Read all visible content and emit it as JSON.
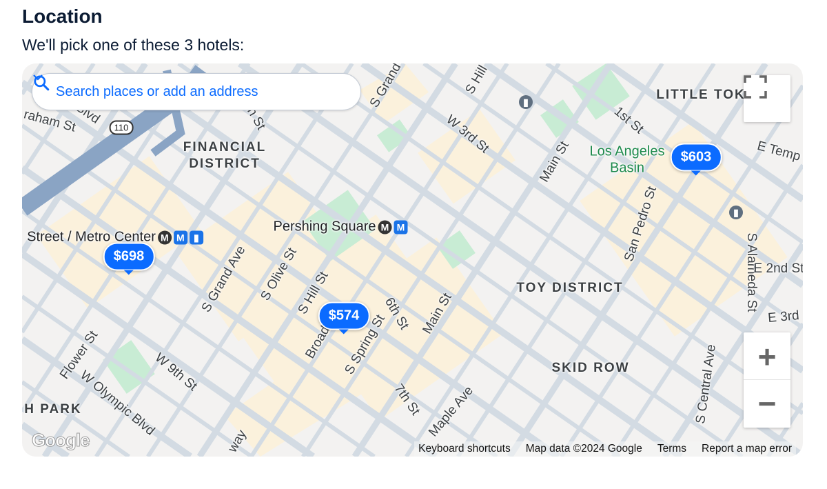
{
  "section": {
    "title": "Location",
    "subtitle": "We'll pick one of these 3 hotels:"
  },
  "map": {
    "search": {
      "placeholder": "Search places or add an address",
      "icon": "search-icon",
      "dropdown_icon": "chevron-down-icon"
    },
    "markers": [
      {
        "price": "$698"
      },
      {
        "price": "$574"
      },
      {
        "price": "$603"
      }
    ],
    "highway_shield": "110",
    "districts": [
      "FINANCIAL",
      "DISTRICT",
      "LITTLE TOK",
      "TOY DISTRICT",
      "SKID ROW",
      "H PARK"
    ],
    "parks": [
      "Los Angeles",
      "Basin"
    ],
    "pois": [
      "Pershing Square",
      "Street / Metro Center"
    ],
    "metro_icons": [
      "M",
      "M",
      "M",
      "M"
    ],
    "streets": [
      "Blvd",
      "raham St",
      "th St",
      "S Grand",
      "S Hill",
      "W 3rd St",
      "1st St",
      "Main St",
      "E Temp",
      "San Pedro St",
      "S Alameda St",
      "E 2nd St",
      "E 3rd",
      "S Grand Ave",
      "S Olive St",
      "S Hill St",
      "6th St",
      "Main St",
      "S Spring St",
      "Broadway",
      "Flower St",
      "W 9th St",
      "W Olympic Blvd",
      "7th St",
      "Maple Ave",
      "S Central Ave",
      "way"
    ],
    "controls": {
      "fullscreen_icon": "fullscreen-icon",
      "zoom_in": "+",
      "zoom_out": "−"
    },
    "logo": "Google",
    "attribution": [
      "Keyboard shortcuts",
      "Map data ©2024 Google",
      "Terms",
      "Report a map error"
    ],
    "colors": {
      "marker": "#0b6bff",
      "road": "#d3dbe3",
      "highway": "#8aa4c4",
      "park": "#c8ecd4",
      "commercial": "#fbf1dc"
    }
  }
}
